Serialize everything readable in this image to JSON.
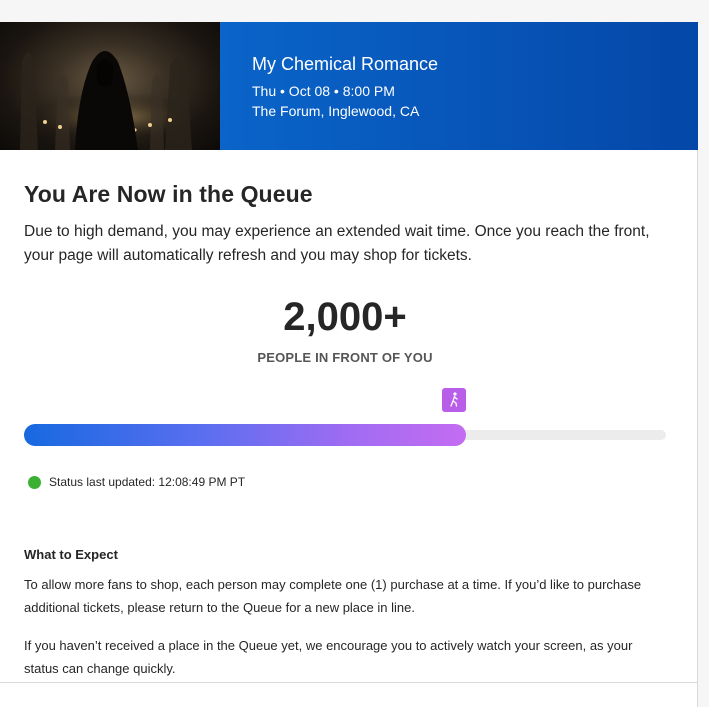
{
  "event": {
    "name": "My Chemical Romance",
    "date": "Thu • Oct 08 • 8:00 PM",
    "venue": "The Forum, Inglewood, CA",
    "image_icon": "hooded-figure-image"
  },
  "queue": {
    "title": "You Are Now in the Queue",
    "description": "Due to high demand, you may experience an extended wait time. Once you reach the front, your page will automatically refresh and you may shop for tickets.",
    "count": "2,000+",
    "count_caption": "PEOPLE IN FRONT OF YOU",
    "progress_fraction": 0.688,
    "marker_icon": "walking-person-icon",
    "status_text": "Status last updated: 12:08:49 PM PT",
    "status_color": "#3cb033"
  },
  "expect": {
    "title": "What to Expect",
    "p1": "To allow more fans to shop, each person may complete one (1) purchase at a time. If you’d like to purchase additional tickets, please return to the Queue for a new place in line.",
    "p2": "If you haven’t received a place in the Queue yet, we encourage you to actively watch your screen, as your status can change quickly."
  },
  "colors": {
    "banner": "#0753b6",
    "progress_start": "#1769e0",
    "progress_end": "#c46cf2"
  }
}
